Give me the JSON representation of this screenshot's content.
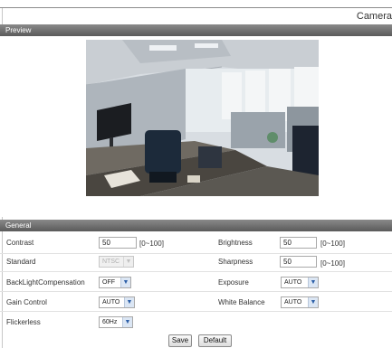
{
  "header": {
    "title": "Camera"
  },
  "preview": {
    "section_title": "Preview"
  },
  "general": {
    "section_title": "General",
    "contrast": {
      "label": "Contrast",
      "value": "50",
      "range": "[0~100]"
    },
    "brightness": {
      "label": "Brightness",
      "value": "50",
      "range": "[0~100]"
    },
    "standard": {
      "label": "Standard",
      "value": "NTSC"
    },
    "sharpness": {
      "label": "Sharpness",
      "value": "50",
      "range": "[0~100]"
    },
    "backlight": {
      "label": "BackLightCompensation",
      "value": "OFF"
    },
    "exposure": {
      "label": "Exposure",
      "value": "AUTO"
    },
    "gain": {
      "label": "Gain Control",
      "value": "AUTO"
    },
    "white_balance": {
      "label": "White Balance",
      "value": "AUTO"
    },
    "flickerless": {
      "label": "Flickerless",
      "value": "60Hz"
    }
  },
  "buttons": {
    "save": "Save",
    "default": "Default"
  },
  "colors": {
    "bar_top": "#8a8a8a",
    "bar_bottom": "#5a5a5a",
    "select_arrow": "#2b5ea7"
  }
}
